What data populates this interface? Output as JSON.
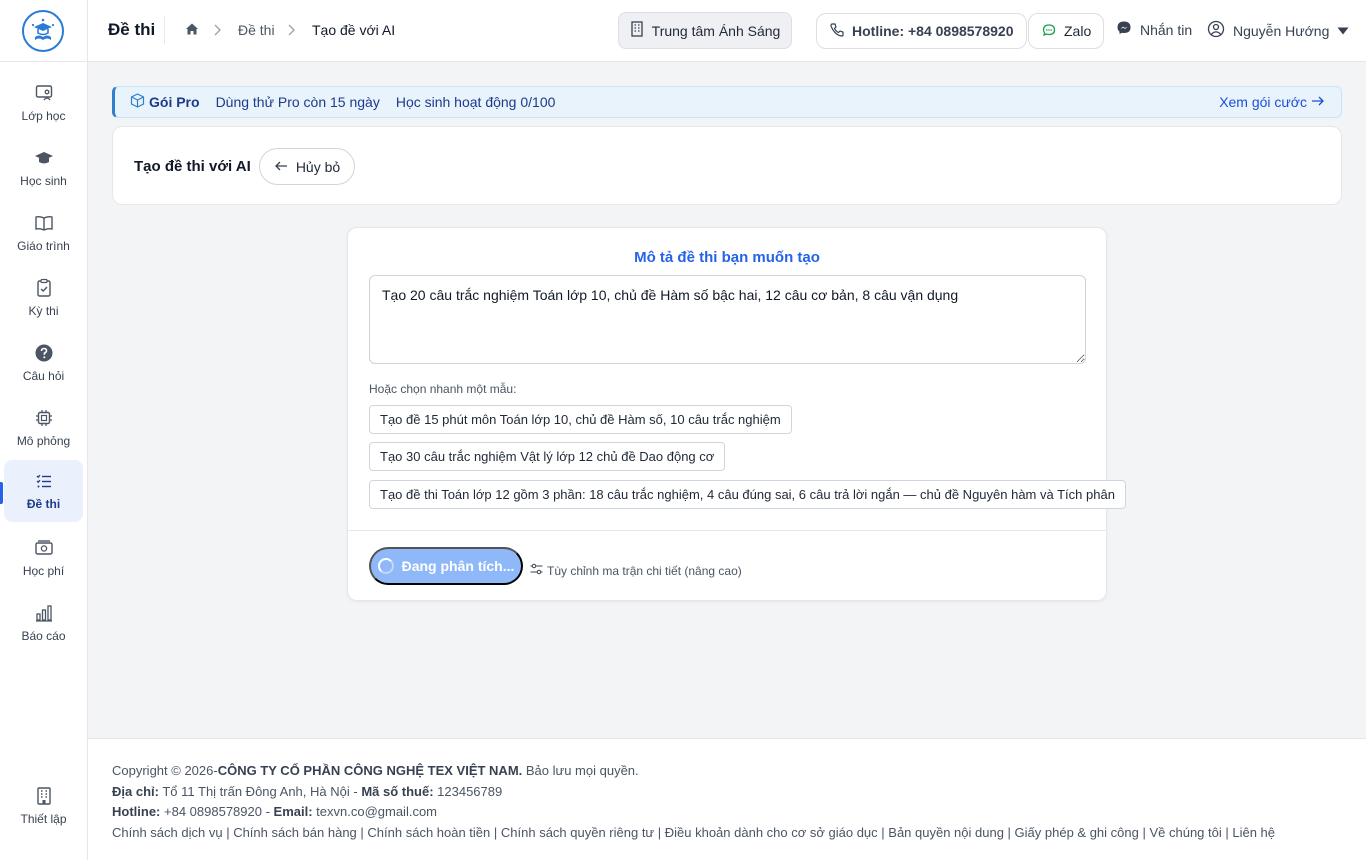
{
  "sidebar": {
    "items": [
      {
        "label": "Lớp học",
        "icon": "classroom-icon"
      },
      {
        "label": "Học sinh",
        "icon": "graduation-cap-icon"
      },
      {
        "label": "Giáo trình",
        "icon": "book-icon"
      },
      {
        "label": "Kỳ thi",
        "icon": "clipboard-check-icon"
      },
      {
        "label": "Câu hỏi",
        "icon": "question-icon"
      },
      {
        "label": "Mô phỏng",
        "icon": "chip-icon"
      },
      {
        "label": "Đề thi",
        "icon": "list-icon"
      },
      {
        "label": "Học phí",
        "icon": "money-icon"
      },
      {
        "label": "Báo cáo",
        "icon": "bar-chart-icon"
      }
    ],
    "active_index": 6,
    "settings_label": "Thiết lập"
  },
  "header": {
    "title": "Đề thi",
    "breadcrumb": [
      "Đề thi",
      "Tạo đề với AI"
    ],
    "center_name": "Trung tâm Ánh Sáng",
    "hotline": "Hotline: +84 0898578920",
    "zalo": "Zalo",
    "message": "Nhắn tin",
    "user": "Nguyễn Hướng"
  },
  "promo": {
    "plan": "Gói Pro",
    "trial": "Dùng thử Pro còn 15 ngày",
    "students": "Học sinh hoạt động 0/100",
    "link": "Xem gói cước"
  },
  "page": {
    "title": "Tạo đề thi với AI",
    "cancel": "Hủy bỏ"
  },
  "form": {
    "title": "Mô tả đề thi bạn muốn tạo",
    "prompt_value": "Tạo 20 câu trắc nghiệm Toán lớp 10, chủ đề Hàm số bậc hai, 12 câu cơ bản, 8 câu vận dụng",
    "quick_label": "Hoặc chọn nhanh một mẫu:",
    "templates": [
      "Tạo đề 15 phút môn Toán lớp 10, chủ đề Hàm số, 10 câu trắc nghiệm",
      "Tạo 30 câu trắc nghiệm Vật lý lớp 12 chủ đề Dao động cơ",
      "Tạo đề thi Toán lớp 12 gồm 3 phần: 18 câu trắc nghiệm, 4 câu đúng sai, 6 câu trả lời ngắn — chủ đề Nguyên hàm và Tích phân"
    ],
    "analyze_button": "Đang phân tích...",
    "advanced_link": "Tùy chỉnh ma trận chi tiết (nâng cao)"
  },
  "footer": {
    "copyright_prefix": "Copyright © 2026-",
    "company": "CÔNG TY CỔ PHẦN CÔNG NGHỆ TEX VIỆT NAM.",
    "rights": " Bảo lưu mọi quyền.",
    "address_label": "Địa chỉ:",
    "address": " Tổ 11 Thị trấn Đông Anh, Hà Nội - ",
    "tax_label": "Mã số thuế:",
    "tax": " 123456789",
    "hotline_label": "Hotline:",
    "hotline": " +84 0898578920 - ",
    "email_label": "Email:",
    "email": " texvn.co@gmail.com",
    "links": [
      "Chính sách dịch vụ",
      "Chính sách bán hàng",
      "Chính sách hoàn tiền",
      "Chính sách quyền riêng tư",
      "Điều khoản dành cho cơ sở giáo dục",
      "Bản quyền nội dung",
      "Giấy phép & ghi công",
      "Về chúng tôi",
      "Liên hệ"
    ]
  },
  "colors": {
    "accent": "#2563eb",
    "active_nav_bg": "#eaf1fc",
    "promo_bg": "#e8f3fc"
  }
}
